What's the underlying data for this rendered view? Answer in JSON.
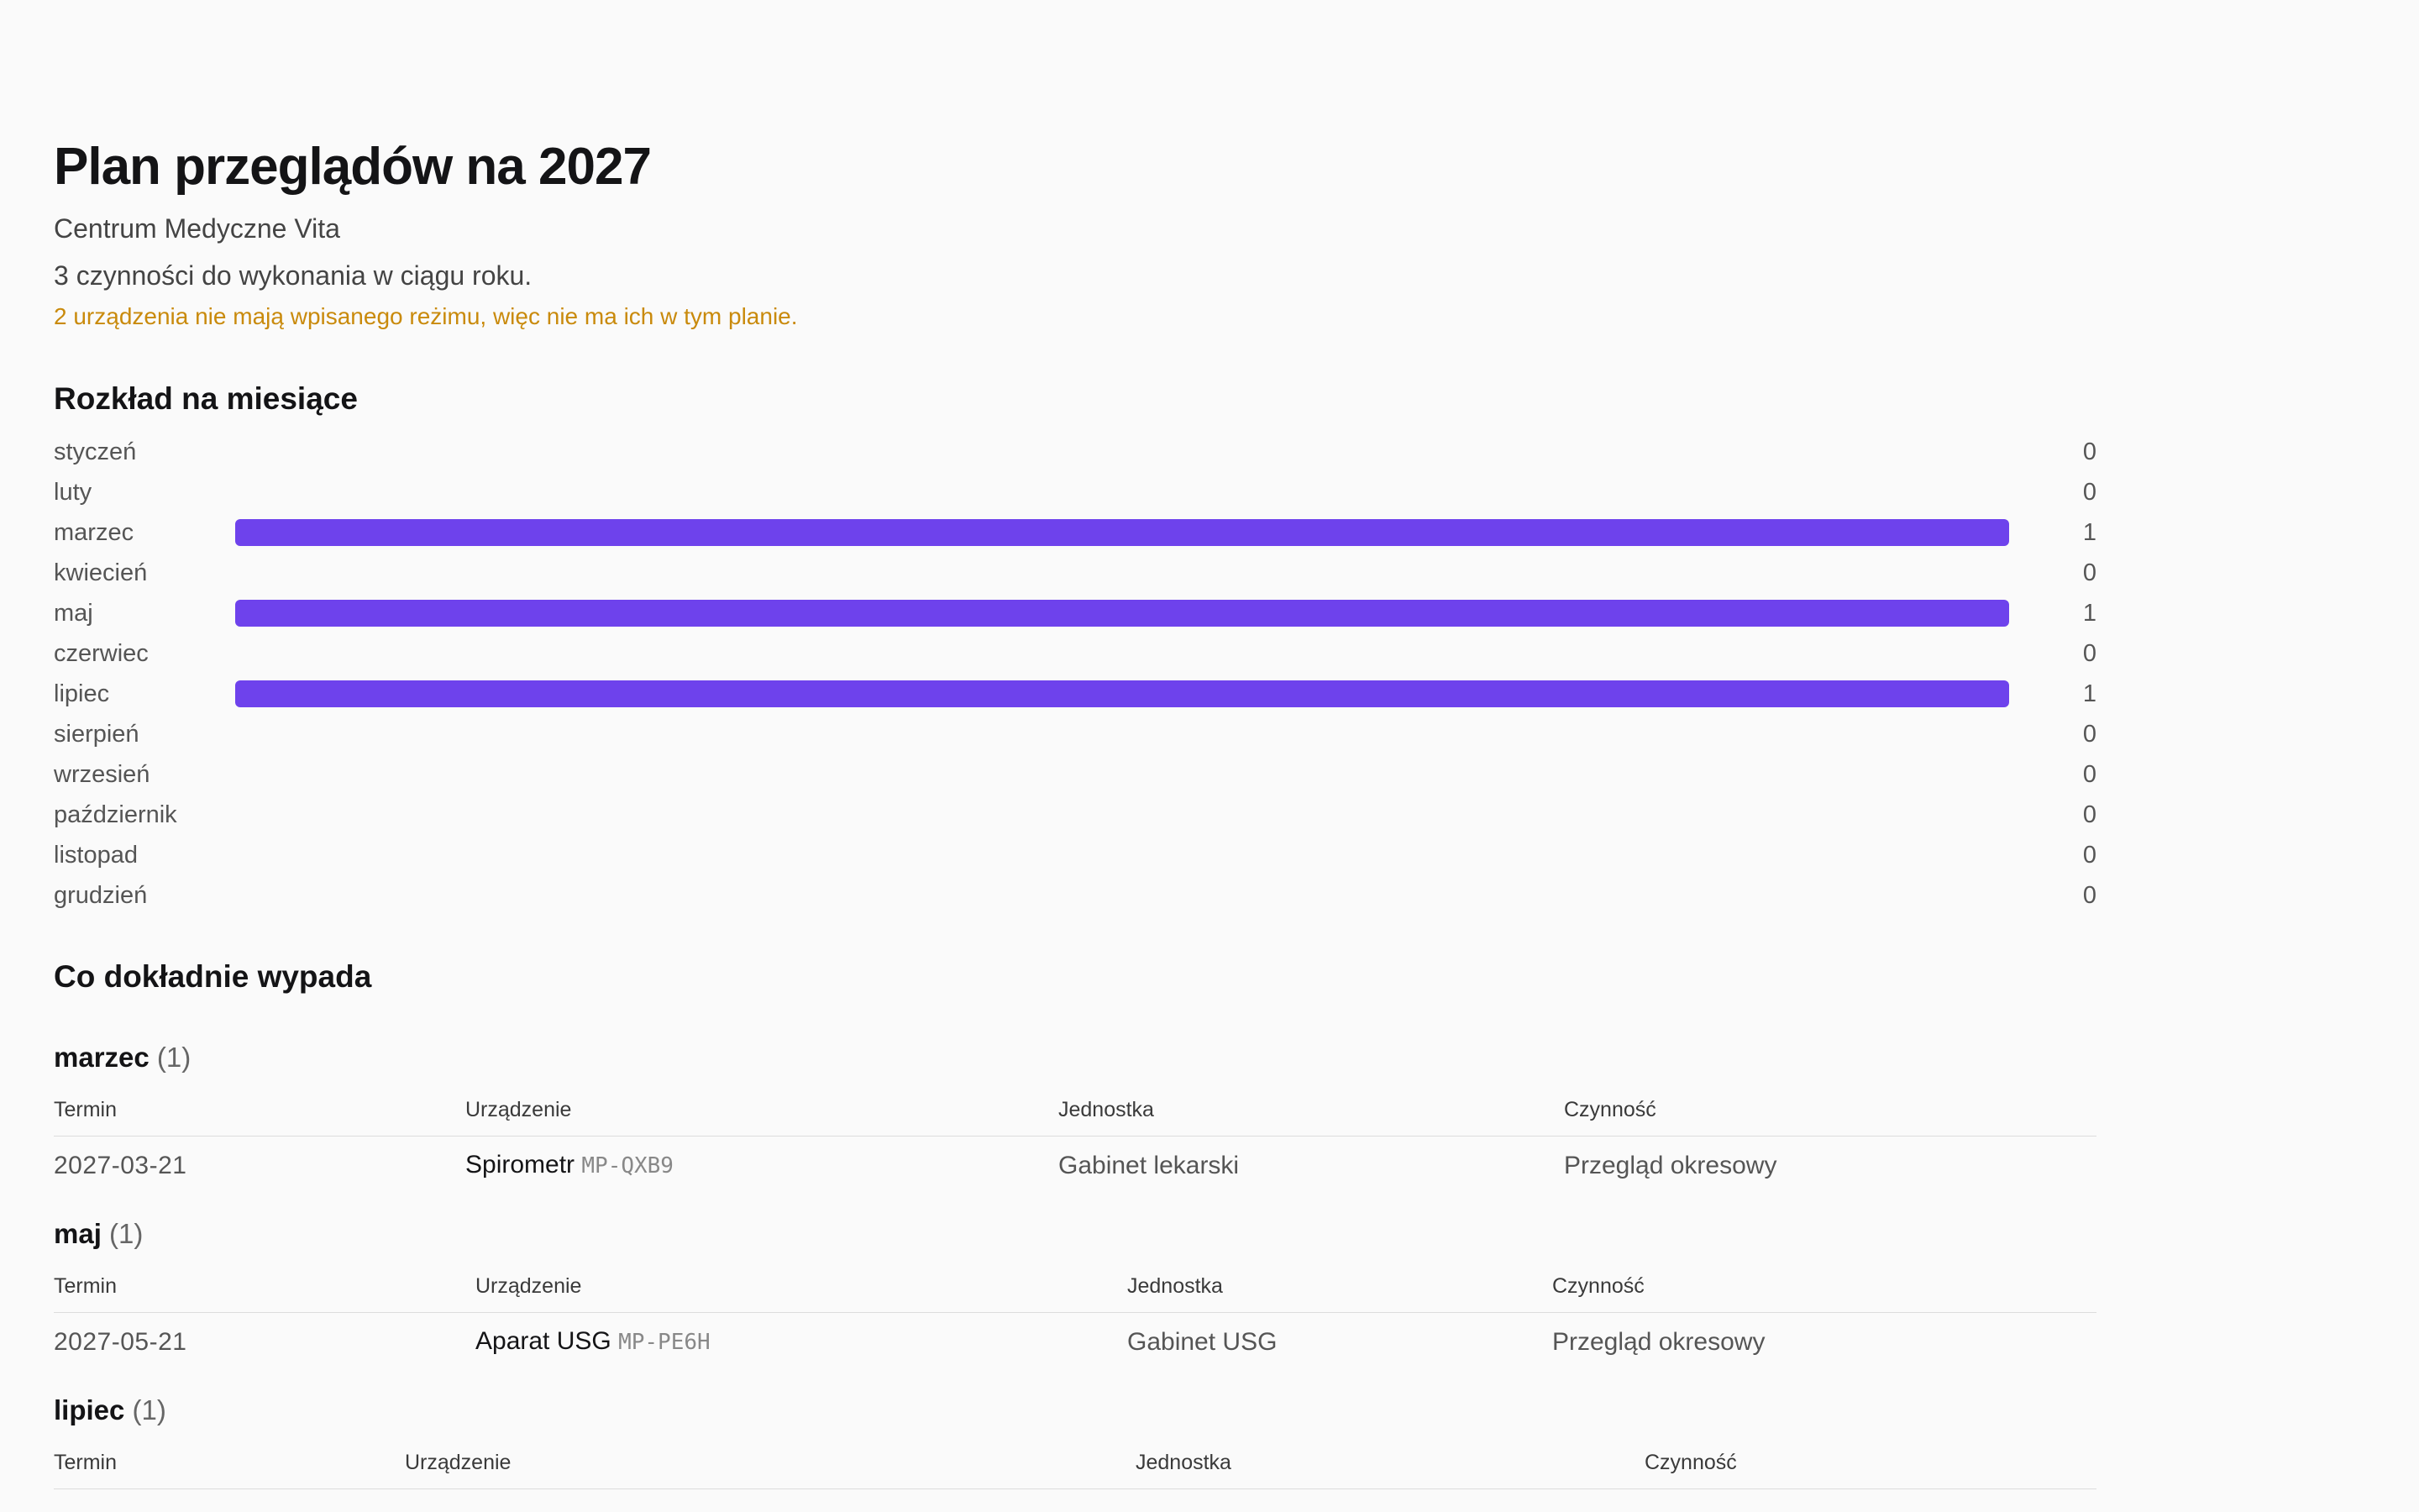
{
  "header": {
    "title": "Plan przeglądów na 2027",
    "organization": "Centrum Medyczne Vita",
    "summary": "3 czynności do wykonania w ciągu roku.",
    "warning": "2 urządzenia nie mają wpisanego reżimu, więc nie ma ich w tym planie."
  },
  "distribution": {
    "title": "Rozkład na miesiące",
    "max": 1,
    "months": [
      {
        "label": "styczeń",
        "count": 0
      },
      {
        "label": "luty",
        "count": 0
      },
      {
        "label": "marzec",
        "count": 1
      },
      {
        "label": "kwiecień",
        "count": 0
      },
      {
        "label": "maj",
        "count": 1
      },
      {
        "label": "czerwiec",
        "count": 0
      },
      {
        "label": "lipiec",
        "count": 1
      },
      {
        "label": "sierpień",
        "count": 0
      },
      {
        "label": "wrzesień",
        "count": 0
      },
      {
        "label": "październik",
        "count": 0
      },
      {
        "label": "listopad",
        "count": 0
      },
      {
        "label": "grudzień",
        "count": 0
      }
    ],
    "bar_color": "#6e42ec"
  },
  "details": {
    "title": "Co dokładnie wypada",
    "columns": {
      "date": "Termin",
      "device": "Urządzenie",
      "unit": "Jednostka",
      "action": "Czynność"
    },
    "groups": [
      {
        "month": "marzec",
        "count": "(1)",
        "rows": [
          {
            "date": "2027-03-21",
            "device": "Spirometr",
            "code": "MP-QXB9",
            "unit": "Gabinet lekarski",
            "action": "Przegląd okresowy"
          }
        ]
      },
      {
        "month": "maj",
        "count": "(1)",
        "rows": [
          {
            "date": "2027-05-21",
            "device": "Aparat USG",
            "code": "MP-PE6H",
            "unit": "Gabinet USG",
            "action": "Przegląd okresowy"
          }
        ]
      },
      {
        "month": "lipiec",
        "count": "(1)",
        "rows": []
      }
    ]
  },
  "colors": {
    "warning": "#c98a0c",
    "accent": "#6e42ec"
  }
}
